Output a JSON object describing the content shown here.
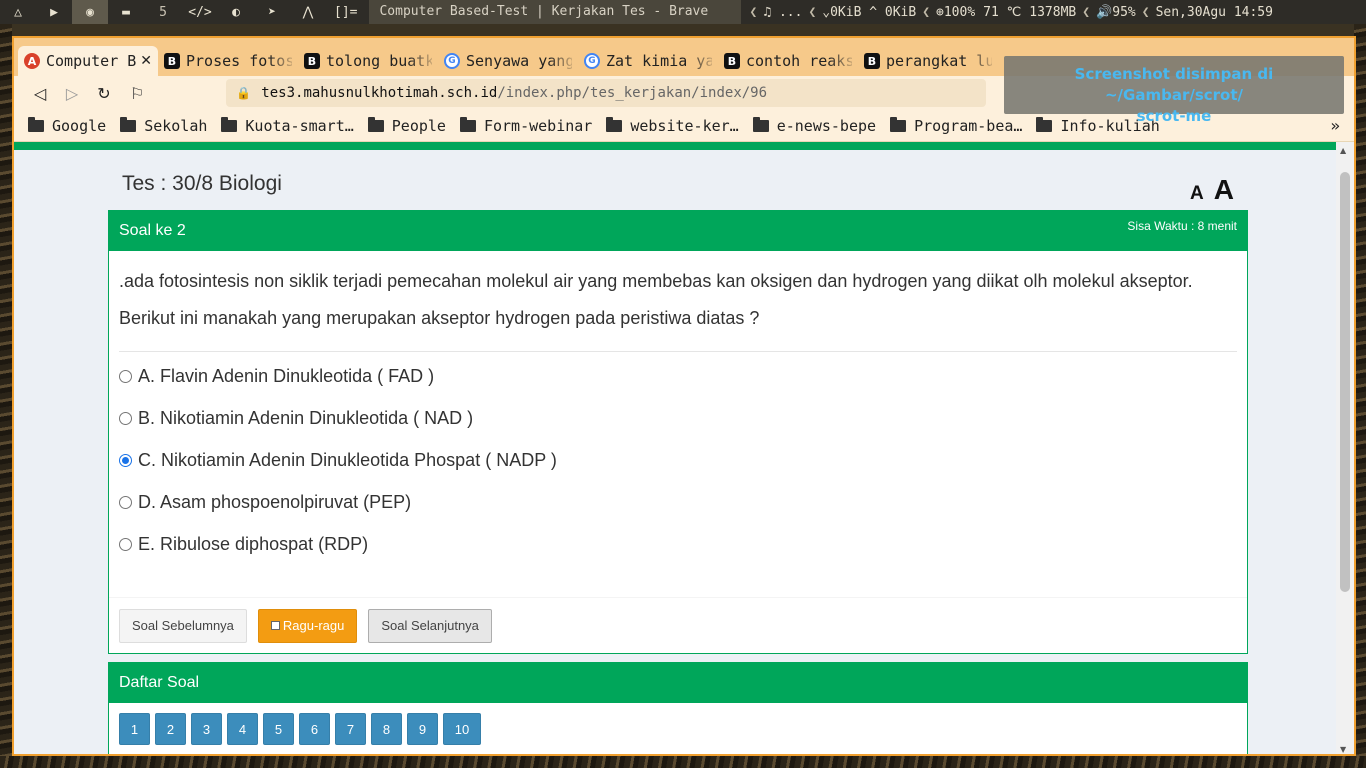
{
  "topbar": {
    "workspace_number": "5",
    "layout_indicator": "[]=",
    "window_title": "Computer Based-Test | Kerjakan Tes - Brave",
    "music": "♫ ...",
    "network": "⌄0KiB ^ 0KiB",
    "cpu": "⊕100%",
    "temp": "71 ℃",
    "mem": "1378MB",
    "volume": "🔊95%",
    "datetime": "Sen,30Agu 14:59"
  },
  "browser": {
    "tabs": [
      {
        "title": "Computer Based-Test",
        "favicon": "cbt",
        "active": true
      },
      {
        "title": "Proses fotosintesis",
        "favicon": "brainly",
        "active": false
      },
      {
        "title": "tolong buatkan",
        "favicon": "brainly",
        "active": false
      },
      {
        "title": "Senyawa yang",
        "favicon": "google",
        "active": false
      },
      {
        "title": "Zat kimia yang",
        "favicon": "google",
        "active": false
      },
      {
        "title": "contoh reaksi",
        "favicon": "brainly",
        "active": false
      },
      {
        "title": "perangkat lunak",
        "favicon": "brainly",
        "active": false
      }
    ],
    "close_glyph": "✕",
    "url_host": "tes3.mahusnulkhotimah.sch.id",
    "url_path": "/index.php/tes_kerjakan/index/96",
    "bookmarks": [
      "Google",
      "Sekolah",
      "Kuota-smart…",
      "People",
      "Form-webinar",
      "website-ker…",
      "e-news-bepe",
      "Program-bea…",
      "Info-kuliah"
    ],
    "bookmarks_more": "»"
  },
  "notification": {
    "line1": "Screenshot disimpan di ~/Gambar/scrot/",
    "line2": "scrot-me"
  },
  "page": {
    "test_title": "Tes : 30/8 Biologi",
    "font_small": "A",
    "font_large": "A",
    "question_header": "Soal ke 2",
    "timer": "Sisa Waktu : 8 menit",
    "question_line1": ".ada fotosintesis non siklik terjadi pemecahan molekul air yang membebas kan oksigen dan hydrogen yang diikat olh molekul akseptor.",
    "question_line2": "Berikut ini manakah yang merupakan akseptor hydrogen pada peristiwa diatas ?",
    "options": [
      {
        "label": "A. Flavin Adenin Dinukleotida ( FAD )",
        "selected": false
      },
      {
        "label": "B. Nikotiamin Adenin Dinukleotida ( NAD )",
        "selected": false
      },
      {
        "label": "C. Nikotiamin Adenin Dinukleotida Phospat ( NADP )",
        "selected": true
      },
      {
        "label": "D. Asam phospoenolpiruvat (PEP)",
        "selected": false
      },
      {
        "label": "E. Ribulose diphospat (RDP)",
        "selected": false
      }
    ],
    "btn_prev": "Soal Sebelumnya",
    "btn_doubt": "Ragu-ragu",
    "btn_next": "Soal Selanjutnya",
    "list_header": "Daftar Soal",
    "numbers": [
      "1",
      "2",
      "3",
      "4",
      "5",
      "6",
      "7",
      "8",
      "9",
      "10"
    ]
  },
  "colors": {
    "green": "#00a65a",
    "orange": "#f39c12",
    "blue": "#3c8dbc",
    "tabstrip": "#f6c98a",
    "toolbar": "#fdf0dc",
    "notification_text": "#49b8f0"
  }
}
